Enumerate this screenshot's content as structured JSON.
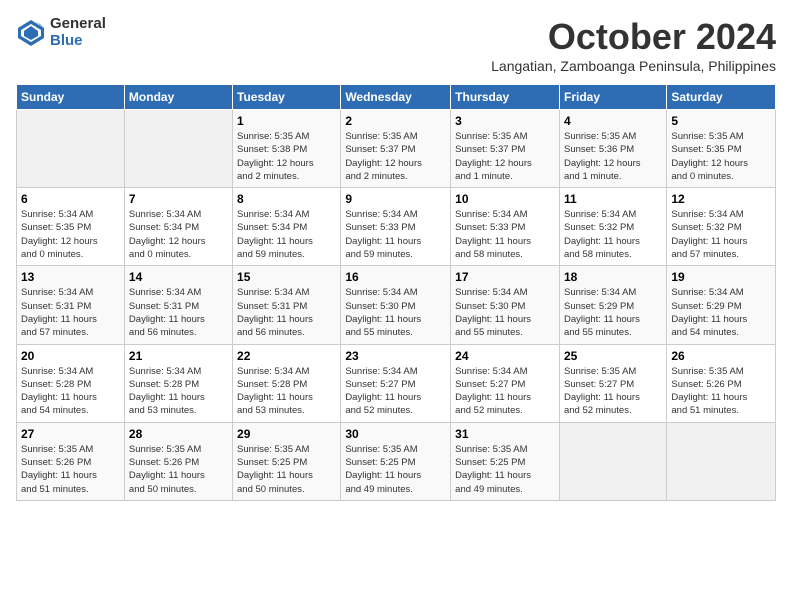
{
  "logo": {
    "general": "General",
    "blue": "Blue"
  },
  "title": {
    "month": "October 2024",
    "location": "Langatian, Zamboanga Peninsula, Philippines"
  },
  "headers": [
    "Sunday",
    "Monday",
    "Tuesday",
    "Wednesday",
    "Thursday",
    "Friday",
    "Saturday"
  ],
  "weeks": [
    [
      {
        "day": "",
        "detail": ""
      },
      {
        "day": "",
        "detail": ""
      },
      {
        "day": "1",
        "detail": "Sunrise: 5:35 AM\nSunset: 5:38 PM\nDaylight: 12 hours\nand 2 minutes."
      },
      {
        "day": "2",
        "detail": "Sunrise: 5:35 AM\nSunset: 5:37 PM\nDaylight: 12 hours\nand 2 minutes."
      },
      {
        "day": "3",
        "detail": "Sunrise: 5:35 AM\nSunset: 5:37 PM\nDaylight: 12 hours\nand 1 minute."
      },
      {
        "day": "4",
        "detail": "Sunrise: 5:35 AM\nSunset: 5:36 PM\nDaylight: 12 hours\nand 1 minute."
      },
      {
        "day": "5",
        "detail": "Sunrise: 5:35 AM\nSunset: 5:35 PM\nDaylight: 12 hours\nand 0 minutes."
      }
    ],
    [
      {
        "day": "6",
        "detail": "Sunrise: 5:34 AM\nSunset: 5:35 PM\nDaylight: 12 hours\nand 0 minutes."
      },
      {
        "day": "7",
        "detail": "Sunrise: 5:34 AM\nSunset: 5:34 PM\nDaylight: 12 hours\nand 0 minutes."
      },
      {
        "day": "8",
        "detail": "Sunrise: 5:34 AM\nSunset: 5:34 PM\nDaylight: 11 hours\nand 59 minutes."
      },
      {
        "day": "9",
        "detail": "Sunrise: 5:34 AM\nSunset: 5:33 PM\nDaylight: 11 hours\nand 59 minutes."
      },
      {
        "day": "10",
        "detail": "Sunrise: 5:34 AM\nSunset: 5:33 PM\nDaylight: 11 hours\nand 58 minutes."
      },
      {
        "day": "11",
        "detail": "Sunrise: 5:34 AM\nSunset: 5:32 PM\nDaylight: 11 hours\nand 58 minutes."
      },
      {
        "day": "12",
        "detail": "Sunrise: 5:34 AM\nSunset: 5:32 PM\nDaylight: 11 hours\nand 57 minutes."
      }
    ],
    [
      {
        "day": "13",
        "detail": "Sunrise: 5:34 AM\nSunset: 5:31 PM\nDaylight: 11 hours\nand 57 minutes."
      },
      {
        "day": "14",
        "detail": "Sunrise: 5:34 AM\nSunset: 5:31 PM\nDaylight: 11 hours\nand 56 minutes."
      },
      {
        "day": "15",
        "detail": "Sunrise: 5:34 AM\nSunset: 5:31 PM\nDaylight: 11 hours\nand 56 minutes."
      },
      {
        "day": "16",
        "detail": "Sunrise: 5:34 AM\nSunset: 5:30 PM\nDaylight: 11 hours\nand 55 minutes."
      },
      {
        "day": "17",
        "detail": "Sunrise: 5:34 AM\nSunset: 5:30 PM\nDaylight: 11 hours\nand 55 minutes."
      },
      {
        "day": "18",
        "detail": "Sunrise: 5:34 AM\nSunset: 5:29 PM\nDaylight: 11 hours\nand 55 minutes."
      },
      {
        "day": "19",
        "detail": "Sunrise: 5:34 AM\nSunset: 5:29 PM\nDaylight: 11 hours\nand 54 minutes."
      }
    ],
    [
      {
        "day": "20",
        "detail": "Sunrise: 5:34 AM\nSunset: 5:28 PM\nDaylight: 11 hours\nand 54 minutes."
      },
      {
        "day": "21",
        "detail": "Sunrise: 5:34 AM\nSunset: 5:28 PM\nDaylight: 11 hours\nand 53 minutes."
      },
      {
        "day": "22",
        "detail": "Sunrise: 5:34 AM\nSunset: 5:28 PM\nDaylight: 11 hours\nand 53 minutes."
      },
      {
        "day": "23",
        "detail": "Sunrise: 5:34 AM\nSunset: 5:27 PM\nDaylight: 11 hours\nand 52 minutes."
      },
      {
        "day": "24",
        "detail": "Sunrise: 5:34 AM\nSunset: 5:27 PM\nDaylight: 11 hours\nand 52 minutes."
      },
      {
        "day": "25",
        "detail": "Sunrise: 5:35 AM\nSunset: 5:27 PM\nDaylight: 11 hours\nand 52 minutes."
      },
      {
        "day": "26",
        "detail": "Sunrise: 5:35 AM\nSunset: 5:26 PM\nDaylight: 11 hours\nand 51 minutes."
      }
    ],
    [
      {
        "day": "27",
        "detail": "Sunrise: 5:35 AM\nSunset: 5:26 PM\nDaylight: 11 hours\nand 51 minutes."
      },
      {
        "day": "28",
        "detail": "Sunrise: 5:35 AM\nSunset: 5:26 PM\nDaylight: 11 hours\nand 50 minutes."
      },
      {
        "day": "29",
        "detail": "Sunrise: 5:35 AM\nSunset: 5:25 PM\nDaylight: 11 hours\nand 50 minutes."
      },
      {
        "day": "30",
        "detail": "Sunrise: 5:35 AM\nSunset: 5:25 PM\nDaylight: 11 hours\nand 49 minutes."
      },
      {
        "day": "31",
        "detail": "Sunrise: 5:35 AM\nSunset: 5:25 PM\nDaylight: 11 hours\nand 49 minutes."
      },
      {
        "day": "",
        "detail": ""
      },
      {
        "day": "",
        "detail": ""
      }
    ]
  ]
}
